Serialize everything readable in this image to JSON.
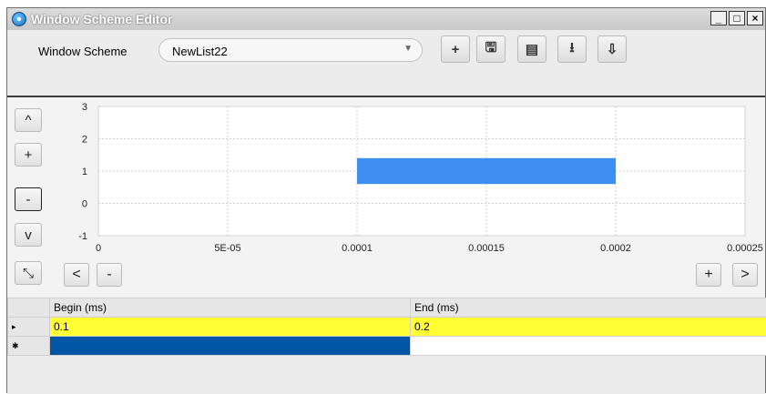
{
  "window": {
    "title": "Window Scheme Editor",
    "controls": [
      "_",
      "□",
      "×"
    ]
  },
  "toolbar": {
    "scheme_label": "Window Scheme",
    "scheme_value": "NewList22",
    "buttons": [
      {
        "icon": "add-icon",
        "glyph": "+"
      },
      {
        "icon": "save-icon",
        "glyph": "🖫"
      },
      {
        "icon": "save-all-icon",
        "glyph": "▤"
      },
      {
        "icon": "download-icon",
        "glyph": "⭳"
      },
      {
        "icon": "import-icon",
        "glyph": "⇩"
      }
    ]
  },
  "side_controls": {
    "up": "^",
    "plus": "+",
    "minus": "-",
    "down": "v",
    "fit": "⤡"
  },
  "nav_controls": {
    "left": "<",
    "zoom_out": "-",
    "zoom_in": "+",
    "right": ">"
  },
  "chart_data": {
    "type": "bar",
    "orientation": "horizontal-range",
    "x_ticks": [
      "0",
      "5E-05",
      "0.0001",
      "0.00015",
      "0.0002",
      "0.00025"
    ],
    "y_ticks": [
      "3",
      "2",
      "1",
      "0",
      "-1"
    ],
    "xlim": [
      0,
      0.00025
    ],
    "ylim": [
      -1,
      3
    ],
    "grid": true,
    "color": "#3d8ef0",
    "segments": [
      {
        "x_start": 0.0001,
        "x_end": 0.0002,
        "y_low": 0.6,
        "y_high": 1.4
      }
    ]
  },
  "table": {
    "columns": [
      "Begin (ms)",
      "End (ms)"
    ],
    "rows": [
      [
        "0.1",
        "0.2"
      ]
    ],
    "row_markers": [
      "▸",
      "✱"
    ]
  }
}
